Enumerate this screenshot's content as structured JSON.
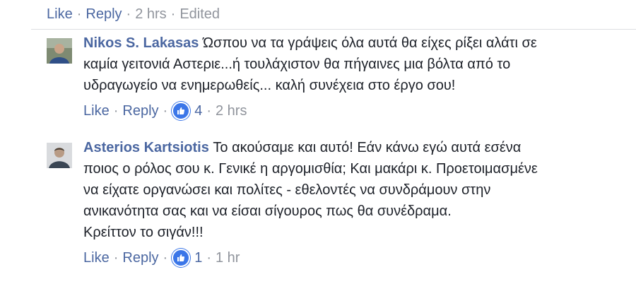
{
  "top": {
    "like_label": "Like",
    "reply_label": "Reply",
    "time": "2 hrs",
    "edited": "Edited"
  },
  "comments": [
    {
      "author": "Nikos S. Lakasas",
      "text": "Ώσπου να τα γράψεις όλα αυτά θα είχες ρίξει αλάτι σε\nκαμία γειτονιά Αστεριε...ή τουλάχιστον θα πήγαινες μια βόλτα από το\nυδραγωγείο να ενημερωθείς... καλή συνέχεια στο έργο σου!",
      "like_label": "Like",
      "reply_label": "Reply",
      "reaction_count": "4",
      "time": "2 hrs",
      "reaction_icon": "thumbs-up-icon"
    },
    {
      "author": "Asterios Kartsiotis",
      "text": "Το ακούσαμε και αυτό! Εάν κάνω εγώ αυτά εσένα\nποιος ο ρόλος σου κ. Γενικέ η αργομισθία; Και μακάρι κ. Προετοιμασμένε\nνα είχατε οργανώσει και πολίτες - εθελοντές να συνδράμουν στην\nανικανότητα σας και να είσαι σίγουρος πως θα συνέδραμα.\nΚρείττον το σιγάν!!!",
      "like_label": "Like",
      "reply_label": "Reply",
      "reaction_count": "1",
      "time": "1 hr",
      "reaction_icon": "thumbs-up-icon"
    }
  ],
  "colors": {
    "link": "#4b67a1",
    "meta": "#90949c",
    "reaction": "#3b76e8"
  }
}
